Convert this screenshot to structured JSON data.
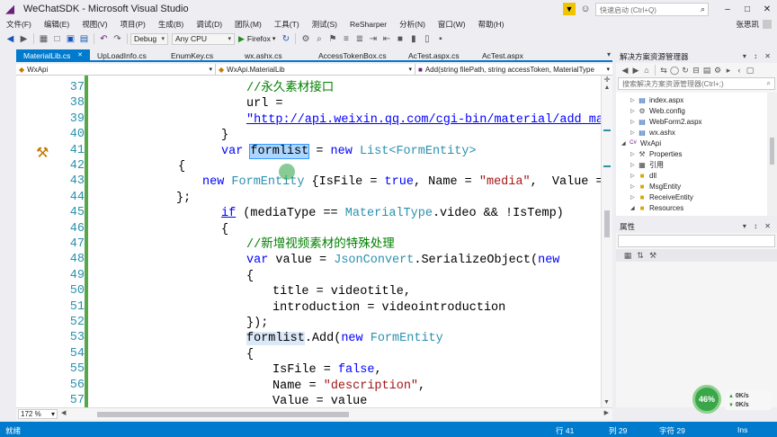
{
  "window": {
    "title": "WeChatSDK - Microsoft Visual Studio",
    "logo_glyph": "◢",
    "quick_launch_placeholder": "快速启动 (Ctrl+Q)",
    "filter_glyph": "▼",
    "feedback_glyph": "☺",
    "search_glyph": "⌕",
    "minimize_glyph": "–",
    "maximize_glyph": "□",
    "close_glyph": "✕"
  },
  "menu": {
    "items": [
      "文件(F)",
      "编辑(E)",
      "视图(V)",
      "项目(P)",
      "生成(B)",
      "调试(D)",
      "团队(M)",
      "工具(T)",
      "测试(S)",
      "ReSharper",
      "分析(N)",
      "窗口(W)",
      "帮助(H)"
    ],
    "user": "张思凯"
  },
  "toolbar": {
    "config": "Debug",
    "platform": "Any CPU",
    "browser": "Firefox",
    "play_glyph": "▶",
    "dropdown_glyph": "▾"
  },
  "tabs": {
    "items": [
      "MaterialLib.cs",
      "UpLoadInfo.cs",
      "EnumKey.cs",
      "wx.ashx.cs",
      "AccessTokenBox.cs",
      "AcTest.aspx.cs",
      "AcTest.aspx"
    ],
    "pin_glyph": "✕",
    "overflow_glyph": "▾"
  },
  "navbar": {
    "project": "WxApi",
    "class": "WxApi.MaterialLib",
    "member": "Add(string filePath, string accessToken, MaterialType",
    "class_glyph": "◆",
    "member_glyph": "■"
  },
  "editor": {
    "line_numbers": [
      "37",
      "38",
      "39",
      "40",
      "41",
      "42",
      "43",
      "44",
      "45",
      "46",
      "47",
      "48",
      "49",
      "50",
      "51",
      "52",
      "53",
      "54",
      "55",
      "56",
      "57"
    ],
    "lines": {
      "l37_comment": "//永久素材接口",
      "l38": "url =",
      "l39_url": "\"http://api.weixin.qq.com/cgi-bin/material/add_material?ac",
      "l40": "}",
      "l41_var": "var ",
      "l41_sel": "formlist",
      "l41_eq": " = ",
      "l41_new": "new ",
      "l41_type": "List<FormEntity>",
      "l42": "{",
      "l43_new": "new ",
      "l43_type": "FormEntity",
      "l43_a": " {IsFile = ",
      "l43_true": "true",
      "l43_b": ", Name = ",
      "l43_str": "\"media\"",
      "l43_c": ",  Value = filePath}",
      "l44": "};",
      "l45_if": "if",
      "l45_a": " (mediaType == ",
      "l45_type": "MaterialType",
      "l45_b": ".video && !IsTemp)",
      "l46": "{",
      "l47_comment": "//新增视频素材的特殊处理",
      "l48_var": "var",
      "l48_a": " value = ",
      "l48_type": "JsonConvert",
      "l48_b": ".SerializeObject(",
      "l48_new": "new",
      "l49": "{",
      "l50": "title = videotitle,",
      "l51": "introduction = videointroduction",
      "l52": "});",
      "l53_sel": "formlist",
      "l53_a": ".Add(",
      "l53_new": "new ",
      "l53_type": "FormEntity",
      "l54": "{",
      "l55_a": "IsFile = ",
      "l55_false": "false",
      "l55_b": ",",
      "l56_a": "Name = ",
      "l56_str": "\"description\"",
      "l56_b": ",",
      "l57": "Value = value"
    },
    "quick_action_glyph": "⚒",
    "split_glyph": "✛",
    "arrow_up": "▲",
    "arrow_down": "▼"
  },
  "bottom": {
    "zoom": "172 %",
    "arrow_left": "◀",
    "arrow_right": "▶",
    "dropdown_glyph": "▾"
  },
  "solution_explorer": {
    "title": "解决方案资源管理器",
    "panel_buttons": "▾ ↕ ✕",
    "search_placeholder": "搜索解决方案资源管理器(Ctrl+;)",
    "search_glyph": "⌕",
    "tree": [
      {
        "label": "index.aspx",
        "icon": "page-icon",
        "glyph": "▤",
        "expander": "▷"
      },
      {
        "label": "Web.config",
        "icon": "config-icon",
        "glyph": "⚙",
        "expander": "▷"
      },
      {
        "label": "WebForm2.aspx",
        "icon": "page-icon",
        "glyph": "▤",
        "expander": "▷"
      },
      {
        "label": "wx.ashx",
        "icon": "page-icon",
        "glyph": "▤",
        "expander": "▷"
      },
      {
        "label": "WxApi",
        "icon": "project-icon",
        "glyph": "C#",
        "expander": "◢"
      },
      {
        "label": "Properties",
        "icon": "wrench-icon",
        "glyph": "⚒",
        "expander": "▷"
      },
      {
        "label": "引用",
        "icon": "references-icon",
        "glyph": "▦",
        "expander": "▷"
      },
      {
        "label": "dll",
        "icon": "folder-icon",
        "glyph": "■",
        "expander": "▷"
      },
      {
        "label": "MsgEntity",
        "icon": "folder-icon",
        "glyph": "■",
        "expander": "▷"
      },
      {
        "label": "ReceiveEntity",
        "icon": "folder-icon",
        "glyph": "■",
        "expander": "▷"
      },
      {
        "label": "Resources",
        "icon": "folder-icon",
        "glyph": "■",
        "expander": "◢"
      }
    ]
  },
  "properties": {
    "title": "属性",
    "panel_buttons": "▾ ↕ ✕"
  },
  "network_widget": {
    "percent": "46%",
    "up": "0K/s",
    "down": "0K/s",
    "up_glyph": "▲",
    "down_glyph": "▼"
  },
  "status": {
    "state": "就绪",
    "row": "行 41",
    "col": "列 29",
    "ch": "字符 29",
    "mode": "Ins"
  },
  "colors": {
    "accent": "#007acc",
    "change_bar": "#57a64a",
    "selection": "#add6ff"
  }
}
